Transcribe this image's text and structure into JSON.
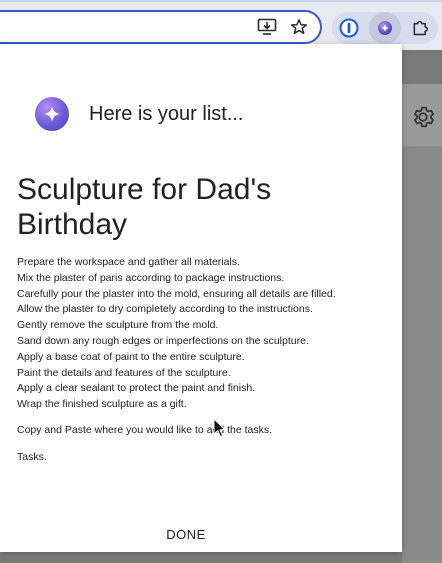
{
  "popup": {
    "greeting": "Here is your list...",
    "title": "Sculpture for Dad's Birthday",
    "tasks": [
      "Prepare the workspace and gather all materials.",
      "Mix the plaster of paris according to package instructions.",
      "Carefully pour the plaster into the mold, ensuring all details are filled.",
      "Allow the plaster to dry completely according to the instructions.",
      "Gently remove the sculpture from the mold.",
      "Sand down any rough edges or imperfections on the sculpture.",
      "Apply a base coat of paint to the entire sculpture.",
      "Paint the details and features of the sculpture.",
      "Apply a clear sealant to protect the paint and finish.",
      "Wrap the finished sculpture as a gift."
    ],
    "instruction": "Copy and Paste where you would like to add the tasks.",
    "tasks_label": "Tasks.",
    "done_label": "DONE"
  },
  "icons": {
    "install_app": "install-app-icon",
    "bookmark": "star-icon",
    "password_manager": "1password-icon",
    "active_extension": "sparkle-extension-icon",
    "extensions": "puzzle-icon",
    "settings": "gear-icon",
    "logo": "sparkle-logo-icon"
  },
  "colors": {
    "accent": "#3b5bcc",
    "logo_gradient_start": "#b48cf0",
    "logo_gradient_end": "#4b3fb8",
    "backdrop": "#7a7a7a"
  }
}
